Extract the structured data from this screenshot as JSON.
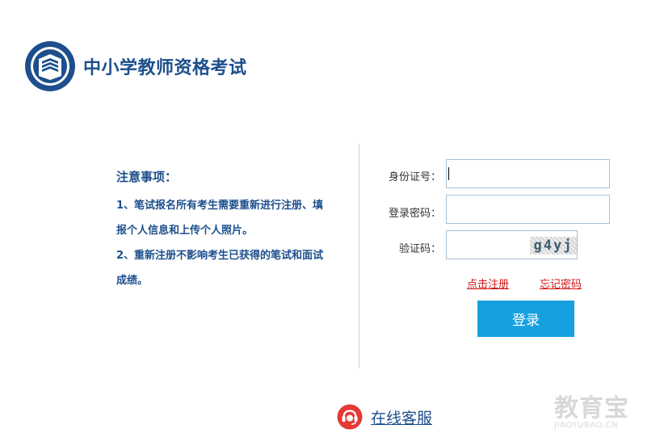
{
  "header": {
    "title": "中小学教师资格考试"
  },
  "notice": {
    "title": "注意事项：",
    "lines": [
      "1、笔试报名所有考生需要重新进行注册、填",
      "报个人信息和上传个人照片。",
      "2、重新注册不影响考生已获得的笔试和面试",
      "成绩。"
    ]
  },
  "form": {
    "id_label": "身份证号：",
    "id_value": "",
    "password_label": "登录密码：",
    "password_value": "",
    "captcha_label": "验证码：",
    "captcha_value": "",
    "captcha_code": "g4yj",
    "register_link": "点击注册",
    "forgot_link": "忘记密码",
    "login_button": "登录"
  },
  "footer": {
    "service_label": "在线客服"
  },
  "watermark": {
    "main": "教育宝",
    "sub": "JIAOYUBAO.CN"
  },
  "colors": {
    "brand": "#1d4f8c",
    "accent": "#15a0e0",
    "link": "#d01515"
  }
}
